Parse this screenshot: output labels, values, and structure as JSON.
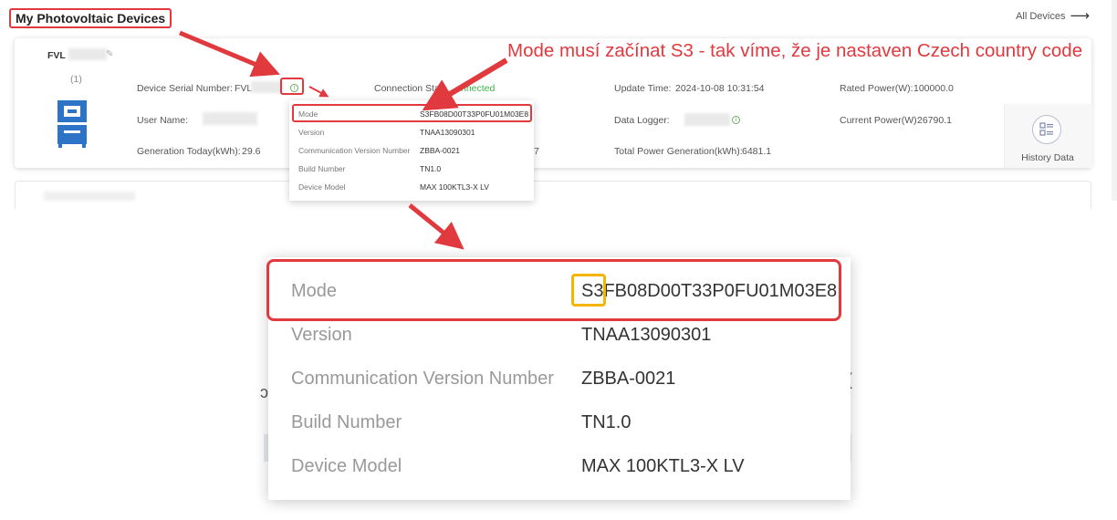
{
  "header": {
    "title": "My Photovoltaic Devices",
    "all_devices": "All Devices"
  },
  "device": {
    "name": "FVL",
    "index": "(1)",
    "serial_label": "Device Serial Number:",
    "serial_value": "FVL",
    "username_label": "User Name:",
    "generation_today_label": "Generation Today(kWh):",
    "generation_today_value": "29.6",
    "connection_label": "Connection Sta",
    "connection_value": "nnected",
    "partial_value": "7",
    "update_time_label": "Update Time:",
    "update_time_value": "2024-10-08 10:31:54",
    "data_logger_label": "Data Logger:",
    "total_gen_label": "Total Power Generation(kWh):",
    "total_gen_value": "6481.1",
    "rated_power_label": "Rated Power(W):",
    "rated_power_value": "100000.0",
    "current_power_label": "Current Power(W):",
    "current_power_value": "26790.1",
    "history_label": "History Data"
  },
  "popup": {
    "rows": [
      {
        "label": "Mode",
        "value": "S3FB08D00T33P0FU01M03E8"
      },
      {
        "label": "Version",
        "value": "TNAA13090301"
      },
      {
        "label": "Communication Version Number",
        "value": "ZBBA-0021"
      },
      {
        "label": "Build Number",
        "value": "TN1.0"
      },
      {
        "label": "Device Model",
        "value": "MAX 100KTL3-X LV"
      }
    ],
    "mode_prefix": "S3",
    "mode_rest": "FB08D00T33P0FU01M03E8"
  },
  "annotation": {
    "text": "Mode musí začínat S3 - tak víme, že je nastaven Czech country code"
  },
  "colors": {
    "annotation_red": "#e0393e",
    "highlight_yellow": "#f4b400",
    "connected_green": "#3bb44a",
    "device_blue": "#2d73c8"
  }
}
